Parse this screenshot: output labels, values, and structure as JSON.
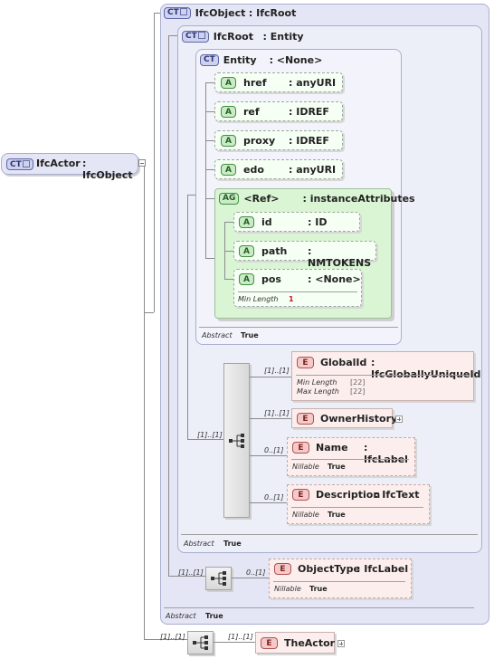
{
  "ifcactor": {
    "badge": "CT",
    "name": "IfcActor",
    "type": ": IfcObject"
  },
  "ifcobject": {
    "badge": "CT",
    "name": "IfcObject",
    "type": ": IfcRoot",
    "abstract_label": "Abstract",
    "abstract_value": "True"
  },
  "ifcroot": {
    "badge": "CT",
    "name": "IfcRoot",
    "type": ": Entity",
    "abstract_label": "Abstract",
    "abstract_value": "True"
  },
  "entity": {
    "badge": "CT",
    "name": "Entity",
    "type": ": <None>",
    "abstract_label": "Abstract",
    "abstract_value": "True"
  },
  "attributes": [
    {
      "badge": "A",
      "name": "href",
      "type": ": anyURI"
    },
    {
      "badge": "A",
      "name": "ref",
      "type": ": IDREF"
    },
    {
      "badge": "A",
      "name": "proxy",
      "type": ": IDREF"
    },
    {
      "badge": "A",
      "name": "edo",
      "type": ": anyURI"
    }
  ],
  "attribute_group": {
    "badge": "AG",
    "name": "<Ref>",
    "type": ": instanceAttributes",
    "items": [
      {
        "badge": "A",
        "name": "id",
        "type": ": ID"
      },
      {
        "badge": "A",
        "name": "path",
        "type": ": NMTOKENS"
      },
      {
        "badge": "A",
        "name": "pos",
        "type": ": <None>",
        "prop_label": "Min Length",
        "prop_value": "1"
      }
    ]
  },
  "ifcroot_sequence": {
    "cardinality": "[1]..[1]",
    "elements": [
      {
        "badge": "E",
        "name": "GlobalId",
        "type": ": IfcGloballyUniqueId",
        "card": "[1]..[1]",
        "props": [
          {
            "label": "Min Length",
            "value": "[22]"
          },
          {
            "label": "Max Length",
            "value": "[22]"
          }
        ]
      },
      {
        "badge": "E",
        "name": "OwnerHistory",
        "card": "[1]..[1]"
      },
      {
        "badge": "E",
        "name": "Name",
        "type": ": IfcLabel",
        "card": "0..[1]",
        "props": [
          {
            "label": "Nillable",
            "value": "True"
          }
        ]
      },
      {
        "badge": "E",
        "name": "Description",
        "type": ": IfcText",
        "card": "0..[1]",
        "props": [
          {
            "label": "Nillable",
            "value": "True"
          }
        ]
      }
    ]
  },
  "ifcobject_sequence": {
    "cardinality": "[1]..[1]",
    "element": {
      "badge": "E",
      "name": "ObjectType",
      "type": ": IfcLabel",
      "card": "0..[1]",
      "props": [
        {
          "label": "Nillable",
          "value": "True"
        }
      ]
    }
  },
  "ifcactor_sequence": {
    "cardinality": "[1]..[1]",
    "element": {
      "badge": "E",
      "name": "TheActor",
      "card": "[1]..[1]"
    }
  }
}
